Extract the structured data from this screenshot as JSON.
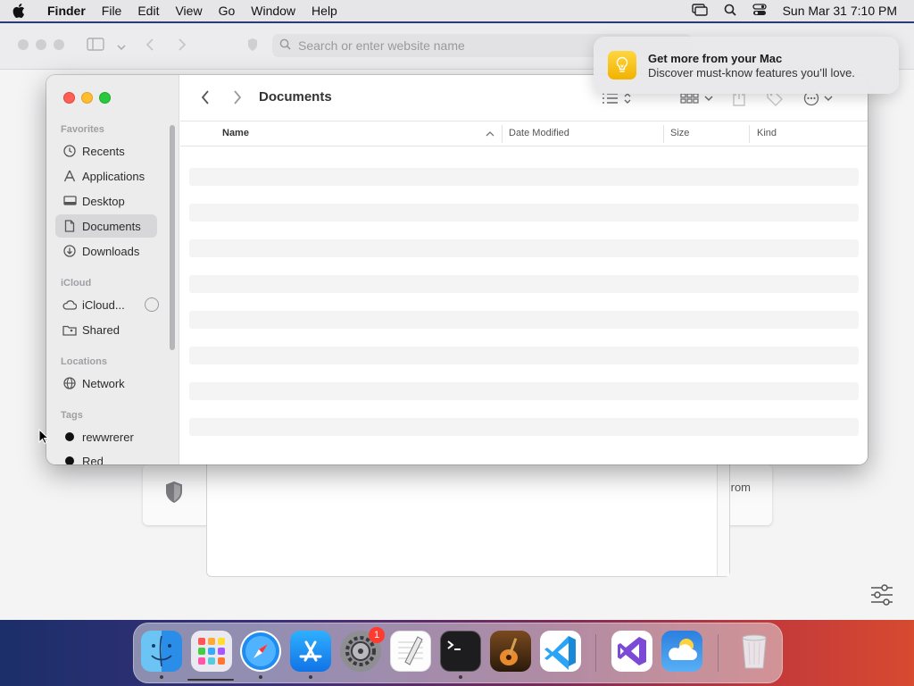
{
  "menubar": {
    "app_name": "Finder",
    "menus": [
      "File",
      "Edit",
      "View",
      "Go",
      "Window",
      "Help"
    ],
    "datetime": "Sun Mar 31  7:10 PM"
  },
  "safari": {
    "address_placeholder": "Search or enter website name",
    "partial_text": "rom"
  },
  "notification": {
    "title": "Get more from your Mac",
    "body": "Discover must-know features you’ll love."
  },
  "finder": {
    "title": "Documents",
    "sidebar": {
      "favorites_header": "Favorites",
      "favorites": [
        {
          "label": "Recents",
          "icon": "clock-icon"
        },
        {
          "label": "Applications",
          "icon": "applications-icon"
        },
        {
          "label": "Desktop",
          "icon": "desktop-icon"
        },
        {
          "label": "Documents",
          "icon": "document-icon",
          "selected": true
        },
        {
          "label": "Downloads",
          "icon": "download-icon"
        }
      ],
      "icloud_header": "iCloud",
      "icloud": [
        {
          "label": "iCloud...",
          "icon": "cloud-icon"
        },
        {
          "label": "Shared",
          "icon": "shared-folder-icon"
        }
      ],
      "locations_header": "Locations",
      "locations": [
        {
          "label": "Network",
          "icon": "globe-icon"
        }
      ],
      "tags_header": "Tags",
      "tags": [
        {
          "label": "rewwrerer",
          "color": "#111111"
        },
        {
          "label": "Red",
          "color": "#111111"
        }
      ]
    },
    "columns": {
      "name": "Name",
      "date_modified": "Date Modified",
      "size": "Size",
      "kind": "Kind"
    }
  },
  "dock": {
    "apps": [
      "Finder",
      "Launchpad",
      "Safari",
      "App Store",
      "System Settings",
      "TextEdit",
      "Terminal",
      "GarageBand",
      "Visual Studio Code",
      "Visual Studio",
      "Weather",
      "Trash"
    ],
    "system_settings_badge": "1"
  }
}
